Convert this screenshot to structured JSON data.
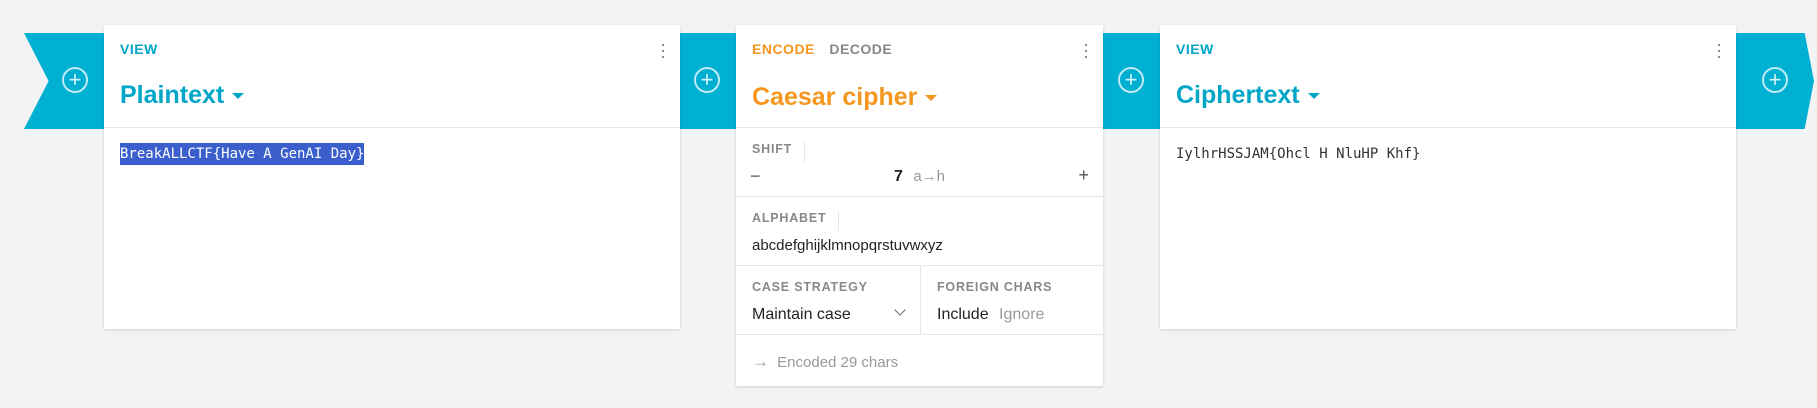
{
  "colors": {
    "accent": "#00b0d3",
    "operation": "#f5961e",
    "selection": "#3a5fcd"
  },
  "input_card": {
    "tag": "VIEW",
    "title": "Plaintext",
    "content": "BreakALLCTF{Have A GenAI Day}"
  },
  "operation_card": {
    "tab_encode": "ENCODE",
    "tab_decode": "DECODE",
    "title": "Caesar cipher",
    "shift": {
      "label": "SHIFT",
      "minus": "−",
      "value": "7",
      "mapping": "a→h",
      "plus": "+"
    },
    "alphabet": {
      "label": "ALPHABET",
      "value": "abcdefghijklmnopqrstuvwxyz"
    },
    "case_strategy": {
      "label": "CASE STRATEGY",
      "value": "Maintain case"
    },
    "foreign_chars": {
      "label": "FOREIGN CHARS",
      "include": "Include",
      "ignore": "Ignore"
    },
    "status": {
      "arrow": "→",
      "text": "Encoded 29 chars"
    }
  },
  "output_card": {
    "tag": "VIEW",
    "title": "Ciphertext",
    "content": "IylhrHSSJAM{Ohcl H NluHP Khf}"
  },
  "icons": {
    "add": "plus-circle-icon",
    "menu": "kebab-icon",
    "dropdown": "caret-down-icon"
  }
}
